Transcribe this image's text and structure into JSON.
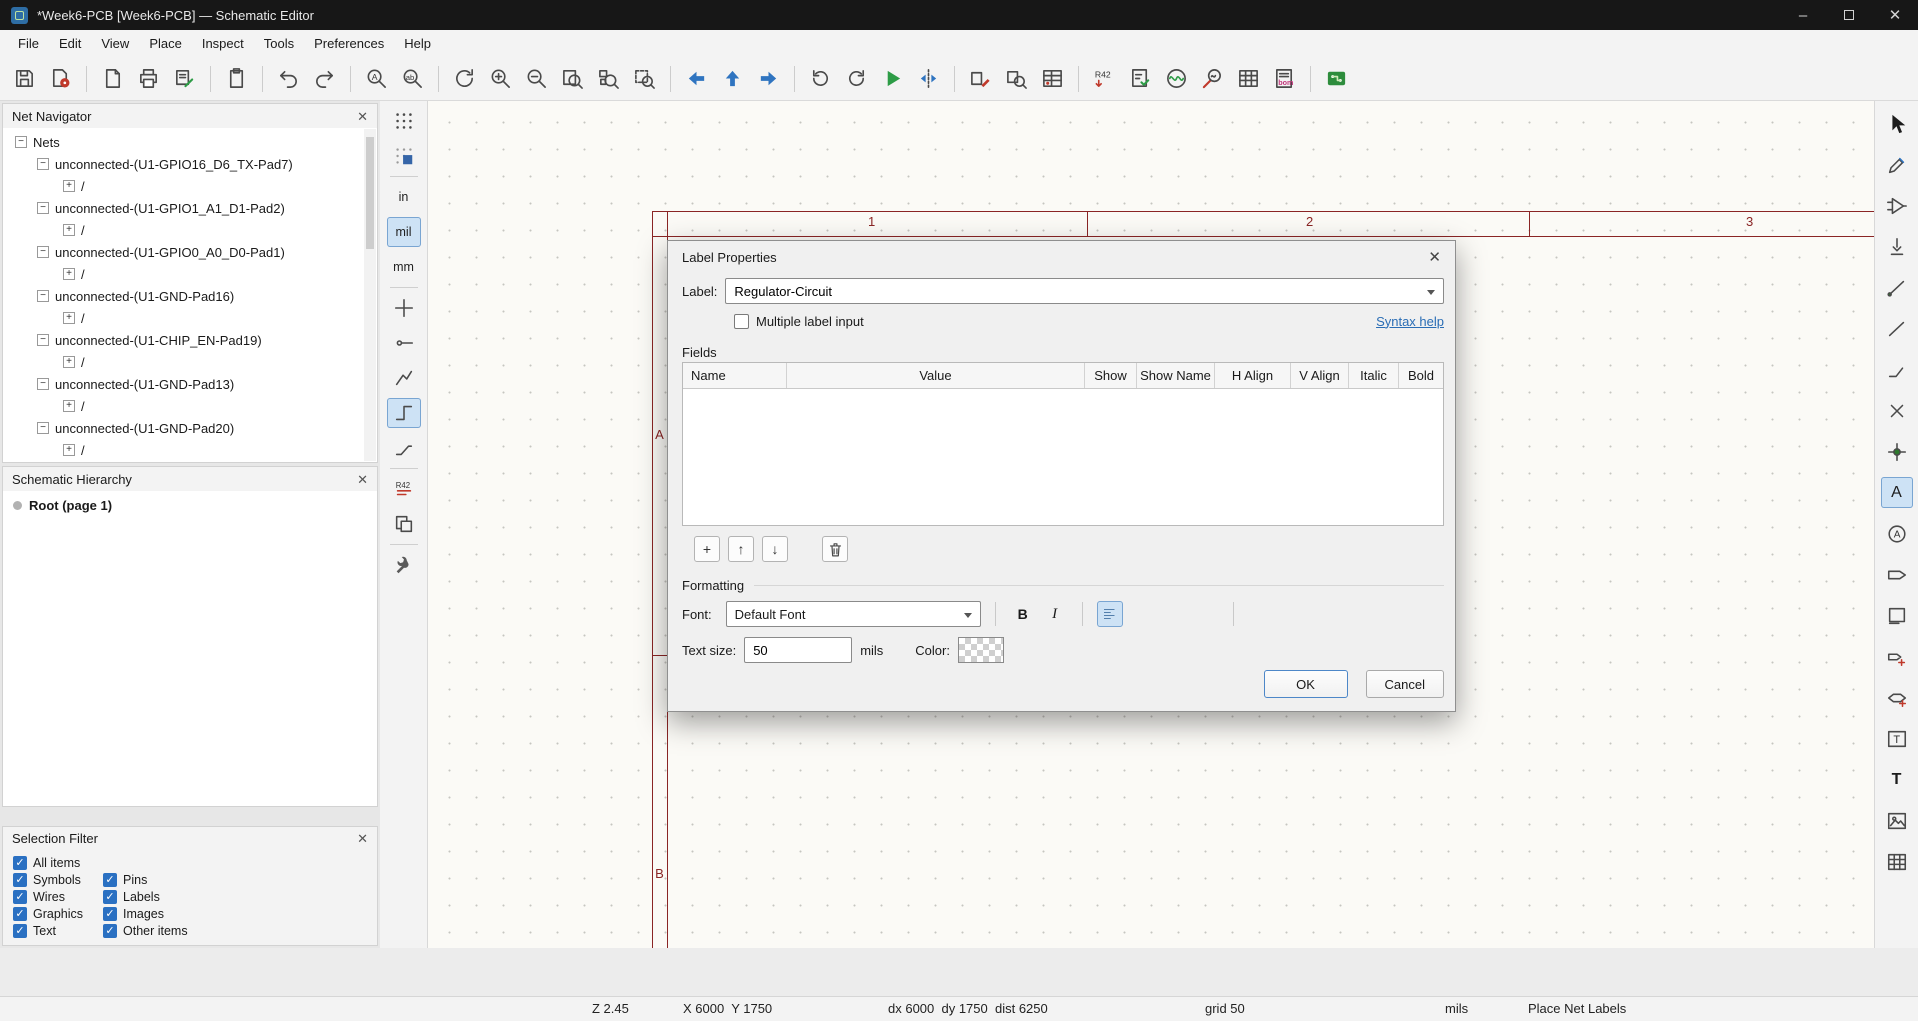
{
  "window": {
    "title": "*Week6-PCB [Week6-PCB] — Schematic Editor"
  },
  "glyphs": {
    "close": "✕",
    "minimize": "–",
    "check": "✓",
    "collapse": "−",
    "expand": "+",
    "plus": "+",
    "up_arrow": "↑",
    "down_arrow": "↓"
  },
  "menubar": {
    "items": [
      "File",
      "Edit",
      "View",
      "Place",
      "Inspect",
      "Tools",
      "Preferences",
      "Help"
    ]
  },
  "toolbar": {
    "icons": [
      "save",
      "sheet-settings",
      "new-sheet",
      "print",
      "plot",
      "paste",
      "undo",
      "redo",
      "find",
      "find-replace",
      "refresh-view",
      "zoom-in",
      "zoom-out",
      "zoom-fit",
      "zoom-objects",
      "zoom-selection",
      "nav-back",
      "nav-up",
      "nav-forward",
      "rotate-ccw",
      "rotate-cw",
      "run-simulation",
      "mirror",
      "edit-symbol",
      "browse-symbols",
      "symbol-fields-table",
      "annotate",
      "erc",
      "simulator",
      "probe",
      "net-table",
      "bom",
      "open-pcb"
    ],
    "find_glyph": "A",
    "find_replace_glyph": "ab",
    "annotate_text": "R42",
    "bom_text": "bom"
  },
  "left_toolbar": {
    "icons": [
      "grid-visibility",
      "grid-override",
      "units-inches",
      "units-mils",
      "units-mm",
      "crosshair-cursor",
      "hidden-pins",
      "line-graph",
      "hv-wire-mode",
      "any-angle-wire-mode",
      "show-values",
      "sheet-pins",
      "preferences-wrench"
    ],
    "units_in": "in",
    "units_mil": "mil",
    "units_mm": "mm",
    "values_text": "R42"
  },
  "net_navigator": {
    "title": "Net Navigator",
    "root": "Nets",
    "child_label": "/",
    "items": [
      "unconnected-(U1-GPIO16_D6_TX-Pad7)",
      "unconnected-(U1-GPIO1_A1_D1-Pad2)",
      "unconnected-(U1-GPIO0_A0_D0-Pad1)",
      "unconnected-(U1-GND-Pad16)",
      "unconnected-(U1-CHIP_EN-Pad19)",
      "unconnected-(U1-GND-Pad13)",
      "unconnected-(U1-GND-Pad20)"
    ]
  },
  "hierarchy": {
    "title": "Schematic Hierarchy",
    "root_label": "Root (page 1)"
  },
  "selection_filter": {
    "title": "Selection Filter",
    "items": [
      {
        "label": "All items",
        "checked": true
      },
      {
        "label": "Symbols",
        "checked": true
      },
      {
        "label": "Pins",
        "checked": true
      },
      {
        "label": "Wires",
        "checked": true
      },
      {
        "label": "Labels",
        "checked": true
      },
      {
        "label": "Graphics",
        "checked": true
      },
      {
        "label": "Images",
        "checked": true
      },
      {
        "label": "Text",
        "checked": true
      },
      {
        "label": "Other items",
        "checked": true
      }
    ]
  },
  "canvas": {
    "sheet_columns": [
      "1",
      "2",
      "3"
    ],
    "sheet_rows": [
      "A",
      "B"
    ]
  },
  "dialog": {
    "title": "Label Properties",
    "label_caption": "Label:",
    "label_value": "Regulator-Circuit",
    "multiple_label": "Multiple label input",
    "syntax_help": "Syntax help",
    "fields_caption": "Fields",
    "table_headers": [
      "Name",
      "Value",
      "Show",
      "Show Name",
      "H Align",
      "V Align",
      "Italic",
      "Bold"
    ],
    "formatting_caption": "Formatting",
    "font_caption": "Font:",
    "font_value": "Default Font",
    "bold_label": "B",
    "italic_label": "I",
    "text_size_caption": "Text size:",
    "text_size_value": "50",
    "units": "mils",
    "color_caption": "Color:",
    "ok_label": "OK",
    "cancel_label": "Cancel"
  },
  "right_toolbar": {
    "icons": [
      "selection-tool",
      "highlight-net",
      "place-symbol",
      "place-power",
      "draw-wire",
      "draw-bus",
      "bus-entry",
      "no-connect",
      "junction",
      "net-label",
      "directive-label",
      "hierarchical-label",
      "hierarchical-sheet",
      "sheet-pin",
      "global-label",
      "text-box",
      "text",
      "image",
      "table"
    ],
    "active_tool": "net-label",
    "net_label_text": "A",
    "directive_text": "A",
    "text_tool_text": "T"
  },
  "statusbar": {
    "zoom": "Z 2.45",
    "cursor": "X 6000  Y 1750",
    "delta": "dx 6000  dy 1750  dist 6250",
    "grid": "grid 50",
    "units": "mils",
    "tool": "Place Net Labels"
  }
}
